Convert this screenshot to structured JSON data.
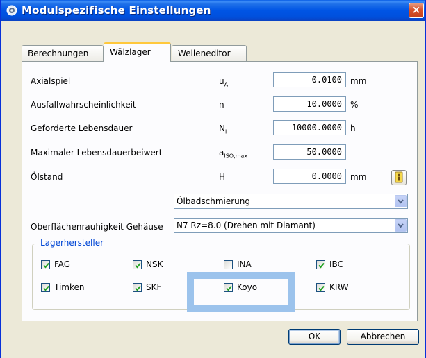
{
  "window": {
    "title": "Modulspezifische Einstellungen",
    "close_label": "×"
  },
  "tabs": [
    {
      "label": "Berechnungen",
      "active": false
    },
    {
      "label": "Wälzlager",
      "active": true
    },
    {
      "label": "Welleneditor",
      "active": false
    }
  ],
  "fields": [
    {
      "label": "Axialspiel",
      "symbol": "u",
      "symbol_sub": "A",
      "value": "0.0100",
      "unit": "mm"
    },
    {
      "label": "Ausfallwahrscheinlichkeit",
      "symbol": "n",
      "symbol_sub": "",
      "value": "10.0000",
      "unit": "%"
    },
    {
      "label": "Geforderte Lebensdauer",
      "symbol": "N",
      "symbol_sub": "l",
      "value": "10000.0000",
      "unit": "h"
    },
    {
      "label": "Maximaler Lebensdauerbeiwert",
      "symbol": "a",
      "symbol_sub": "ISO,max",
      "value": "50.0000",
      "unit": ""
    },
    {
      "label": "Ölstand",
      "symbol": "H",
      "symbol_sub": "",
      "value": "0.0000",
      "unit": "mm"
    }
  ],
  "lubrication_select": {
    "value": "Ölbadschmierung"
  },
  "roughness": {
    "label": "Oberflächenrauhigkeit Gehäuse",
    "value": "N7  Rz=8.0 (Drehen mit Diamant)"
  },
  "manufacturers": {
    "title": "Lagerhersteller",
    "items": [
      {
        "label": "FAG",
        "checked": true
      },
      {
        "label": "NSK",
        "checked": true
      },
      {
        "label": "INA",
        "checked": false
      },
      {
        "label": "IBC",
        "checked": true
      },
      {
        "label": "Timken",
        "checked": true
      },
      {
        "label": "SKF",
        "checked": true
      },
      {
        "label": "Koyo",
        "checked": true
      },
      {
        "label": "KRW",
        "checked": true
      }
    ]
  },
  "buttons": {
    "ok": "OK",
    "cancel": "Abbrechen"
  },
  "colors": {
    "titlebar": "#0055e5",
    "highlight": "#9cc3ec",
    "group_title": "#0046d5"
  }
}
